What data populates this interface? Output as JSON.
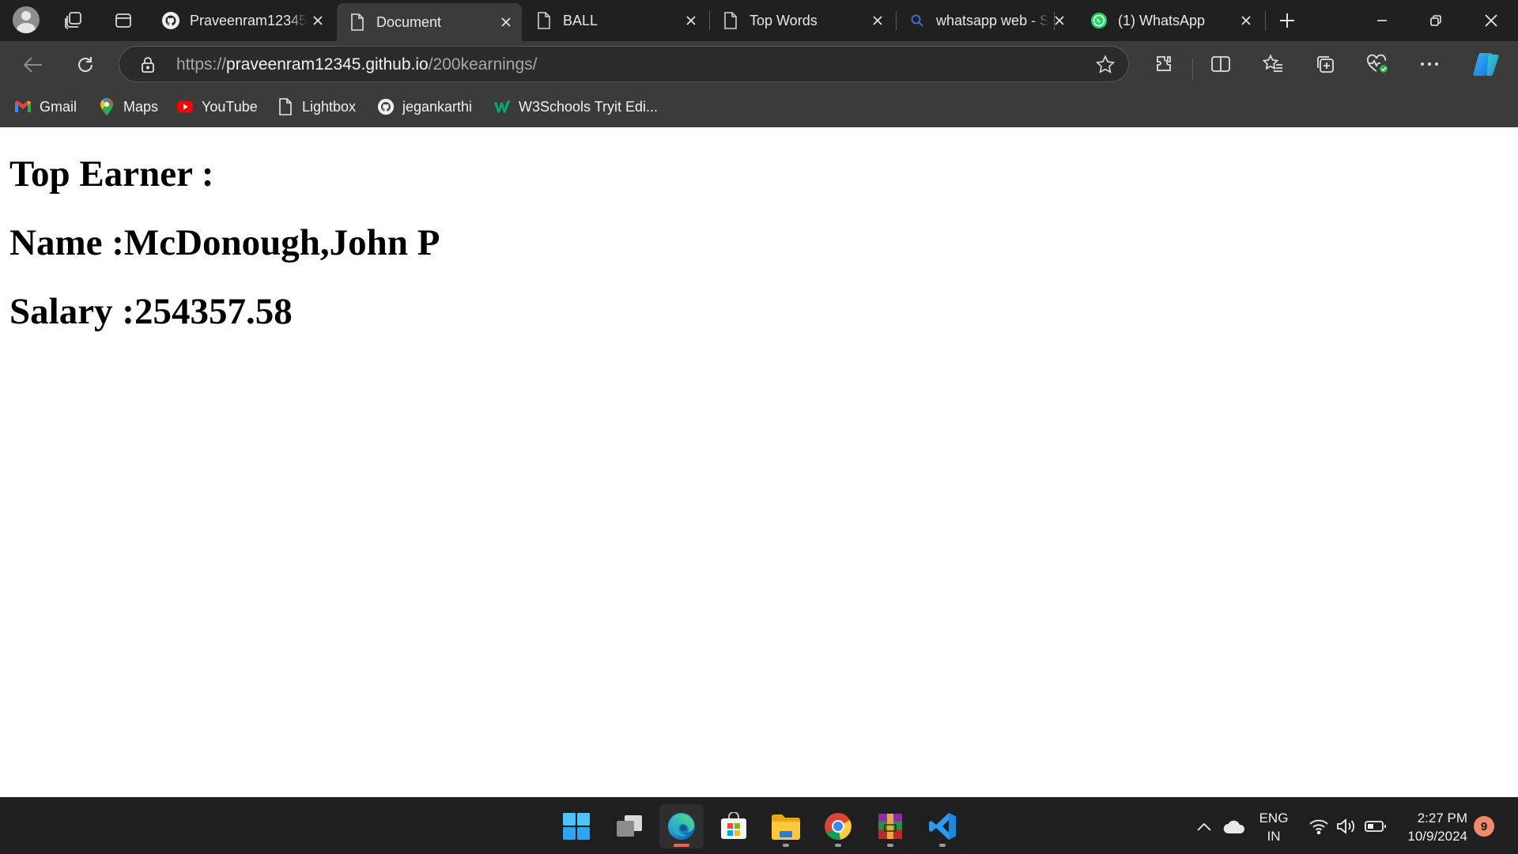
{
  "browser": {
    "tabs": [
      {
        "label": "Praveenram12345",
        "icon": "github-icon",
        "active": false
      },
      {
        "label": "Document",
        "icon": "page-icon",
        "active": true
      },
      {
        "label": "BALL",
        "icon": "page-icon",
        "active": false
      },
      {
        "label": "Top Words",
        "icon": "page-icon",
        "active": false
      },
      {
        "label": "whatsapp web - S",
        "icon": "search-icon",
        "active": false
      },
      {
        "label": "(1) WhatsApp",
        "icon": "whatsapp-icon",
        "active": false
      }
    ],
    "address": {
      "scheme": "https://",
      "host": "praveenram12345.github.io",
      "path": "/200kearnings/"
    },
    "favorites": [
      {
        "label": "Gmail",
        "icon": "gmail-icon"
      },
      {
        "label": "Maps",
        "icon": "maps-icon"
      },
      {
        "label": "YouTube",
        "icon": "youtube-icon"
      },
      {
        "label": "Lightbox",
        "icon": "page-icon"
      },
      {
        "label": "jegankarthi",
        "icon": "github-icon"
      },
      {
        "label": "W3Schools Tryit Edi...",
        "icon": "w3schools-icon"
      }
    ]
  },
  "page": {
    "heading_top": "Top Earner :",
    "name_line": "Name :McDonough,John P",
    "salary_line": "Salary :254357.58"
  },
  "taskbar": {
    "apps": [
      "windows-start-icon",
      "task-view-icon",
      "edge-icon",
      "store-icon",
      "file-explorer-icon",
      "chrome-icon",
      "winrar-icon",
      "vscode-icon"
    ],
    "language_line1": "ENG",
    "language_line2": "IN",
    "time": "2:27 PM",
    "date": "10/9/2024",
    "notification_count": "9"
  },
  "colors": {
    "tabstrip": "#202020",
    "toolbar": "#3b3b3b",
    "taskbar": "#1f1f1f",
    "accent_active_app": "#e06c4e"
  }
}
